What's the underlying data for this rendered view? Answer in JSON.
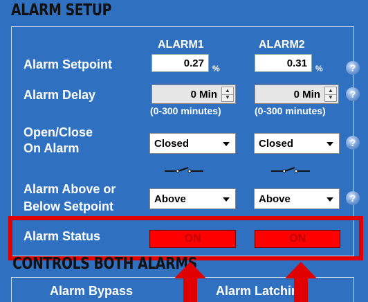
{
  "sections": {
    "alarm_setup": "ALARM SETUP",
    "controls_both": "CONTROLS BOTH ALARMS"
  },
  "columns": {
    "alarm1": "ALARM1",
    "alarm2": "ALARM2"
  },
  "rows": {
    "setpoint": {
      "label": "Alarm Setpoint",
      "alarm1": "0.27",
      "alarm2": "0.31",
      "unit": "%"
    },
    "delay": {
      "label": "Alarm Delay",
      "alarm1": "0 Min",
      "alarm2": "0 Min",
      "range": "(0-300 minutes)"
    },
    "open_close": {
      "label_line1": "Open/Close",
      "label_line2": "On Alarm",
      "alarm1": "Closed",
      "alarm2": "Closed"
    },
    "above_below": {
      "label_line1": "Alarm Above or",
      "label_line2": "Below Setpoint",
      "alarm1": "Above",
      "alarm2": "Above"
    },
    "status": {
      "label": "Alarm Status",
      "alarm1": "ON",
      "alarm2": "ON"
    }
  },
  "controls": {
    "bypass": "Alarm Bypass",
    "latching": "Alarm Latching"
  },
  "help_glyph": "?",
  "spin_up_glyph": "▲",
  "spin_down_glyph": "▼",
  "icons": {
    "help": "help-icon",
    "spinner": "spin-icon",
    "switch": "switch-symbol-icon",
    "arrow": "red-up-arrow-icon"
  },
  "colors": {
    "panel": "#2f70c0",
    "status_on": "#ff0000",
    "highlight": "#e00000"
  }
}
